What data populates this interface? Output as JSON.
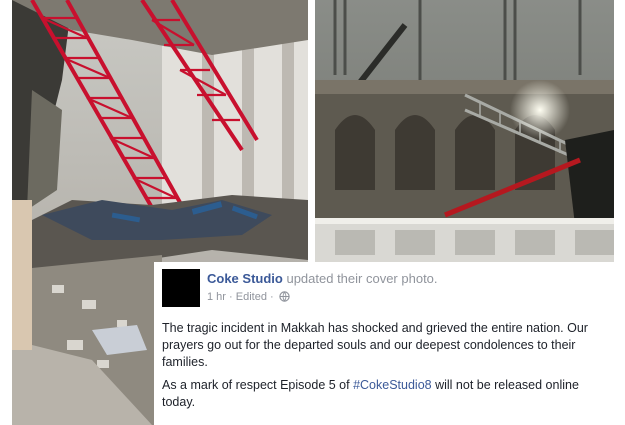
{
  "post": {
    "author": "Coke Studio",
    "action": "updated their cover photo.",
    "time": "1 hr",
    "edited": "Edited",
    "separator": "·",
    "privacy_icon": "globe-icon",
    "paragraph1": "The tragic incident in Makkah has shocked and grieved the entire nation. Our prayers go out for the departed souls and our deepest condolences to their families.",
    "paragraph2_before": "As a mark of respect Episode 5 of ",
    "hashtag": "#CokeStudio8",
    "paragraph2_after": " will not be released online today."
  },
  "colors": {
    "link": "#3b5998",
    "meta": "#90949c",
    "text": "#1d2129",
    "crane_red": "#c8102e"
  }
}
